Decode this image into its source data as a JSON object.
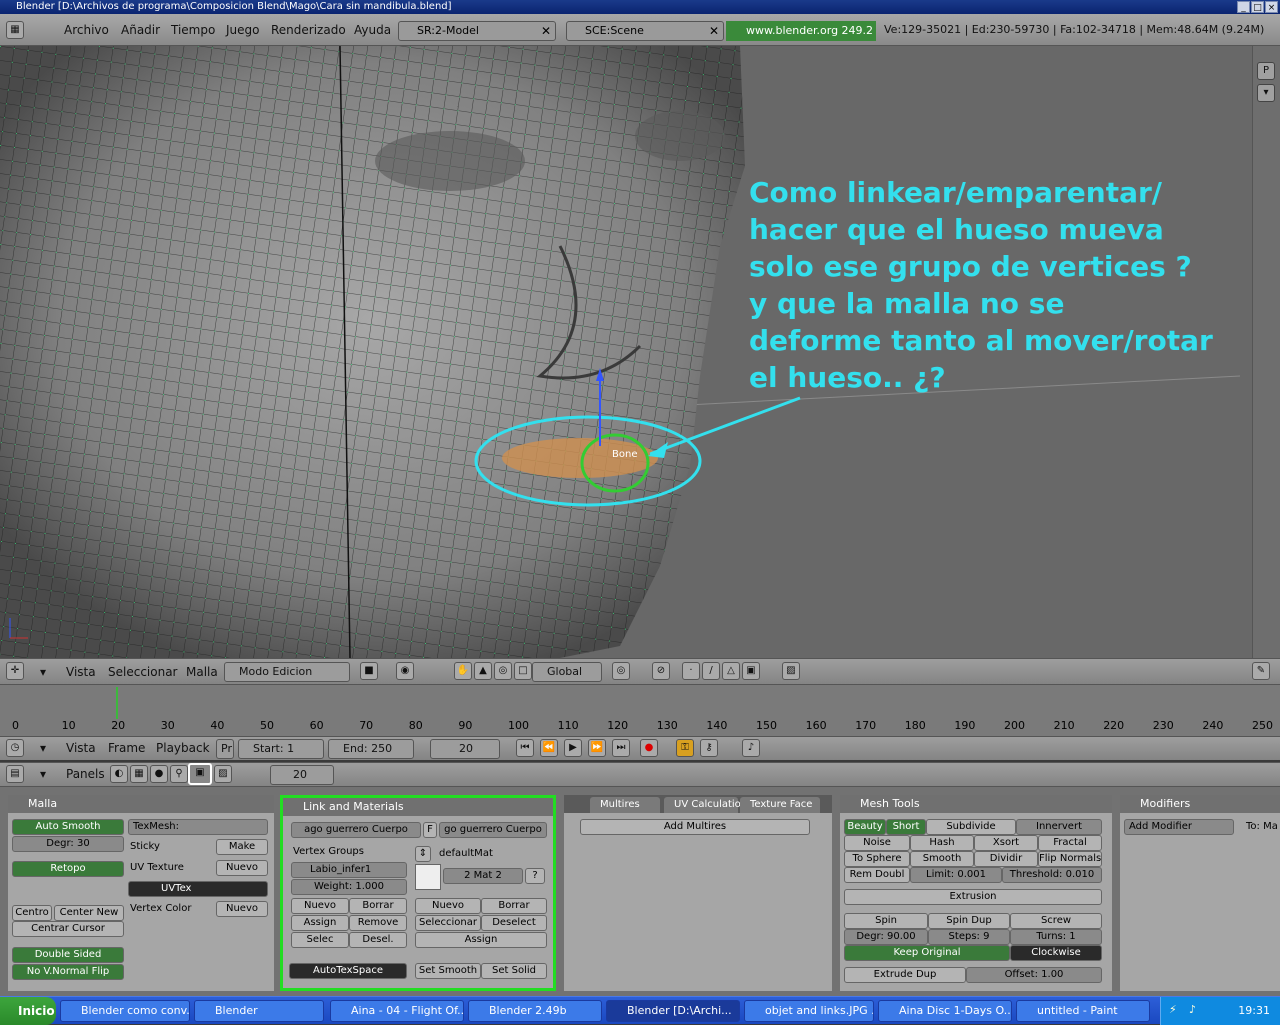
{
  "window": {
    "title": "Blender [D:\\Archivos de programa\\Composicion Blend\\Mago\\Cara sin mandibula.blend]",
    "min": "_",
    "max": "□",
    "close": "×"
  },
  "infobar": {
    "menus": [
      "Archivo",
      "Añadir",
      "Tiempo",
      "Juego",
      "Renderizado",
      "Ayuda"
    ],
    "screen": "SR:2-Model",
    "scene": "SCE:Scene",
    "url": "www.blender.org 249.2",
    "stats": "Ve:129-35021 | Ed:230-59730 | Fa:102-34718 | Mem:48.64M (9.24M)"
  },
  "viewport": {
    "question": "Como linkear/emparentar/\nhacer que el hueso mueva\nsolo ese grupo de vertices ?\ny que la malla no se\ndeforme tanto al mover/rotar\nel hueso.. ¿?",
    "bone_label": "Bone",
    "colors": {
      "annotation": "#33e0ee",
      "wire": "#33ff88",
      "selection": "#33cc33"
    }
  },
  "view_header": {
    "menus": [
      "Vista",
      "Seleccionar",
      "Malla"
    ],
    "mode": "Modo Edicion",
    "orientation": "Global"
  },
  "timeline": {
    "ticks": [
      "0",
      "10",
      "20",
      "30",
      "40",
      "50",
      "60",
      "70",
      "80",
      "90",
      "100",
      "110",
      "120",
      "130",
      "140",
      "150",
      "160",
      "170",
      "180",
      "190",
      "200",
      "210",
      "220",
      "230",
      "240",
      "250"
    ],
    "current_frame_marker": "20"
  },
  "time_header": {
    "menus": [
      "Vista",
      "Frame",
      "Playback"
    ],
    "pr": "Pr",
    "start": "Start: 1",
    "end": "End: 250",
    "frame": "20"
  },
  "btn_header": {
    "label": "Panels",
    "frame": "20"
  },
  "panels": {
    "malla": {
      "title": "Malla",
      "auto_smooth": "Auto Smooth",
      "degr": "Degr: 30",
      "retopo": "Retopo",
      "texmesh": "TexMesh:",
      "sticky": "Sticky",
      "make": "Make",
      "uv_texture": "UV Texture",
      "nuevo": "Nuevo",
      "uvtex": "UVTex",
      "vertex_color": "Vertex Color",
      "nuevo2": "Nuevo",
      "centro": "Centro",
      "center_new": "Center New",
      "centrar_cursor": "Centrar Cursor",
      "double_sided": "Double Sided",
      "no_vnormal_flip": "No V.Normal Flip"
    },
    "link": {
      "title": "Link and Materials",
      "me_field": "ago guerrero Cuerpo",
      "f": "F",
      "ob_field": "go guerrero Cuerpo",
      "vertex_groups": "Vertex Groups",
      "group_name": "Labio_infer1",
      "weight": "Weight: 1.000",
      "nuevo": "Nuevo",
      "borrar": "Borrar",
      "assign": "Assign",
      "remove": "Remove",
      "selec": "Selec",
      "desel": "Desel.",
      "mat_name": "defaultMat",
      "mat_count": "2 Mat 2",
      "q": "?",
      "mnuevo": "Nuevo",
      "mborrar": "Borrar",
      "seleccionar": "Seleccionar",
      "deselect": "Deselect",
      "massign": "Assign",
      "autotexspace": "AutoTexSpace",
      "set_smooth": "Set Smooth",
      "set_solid": "Set Solid"
    },
    "multires": {
      "tabs": [
        "Multires",
        "UV Calculation",
        "Texture Face"
      ],
      "add_multires": "Add Multires"
    },
    "meshtools": {
      "title": "Mesh Tools",
      "beauty": "Beauty",
      "short": "Short",
      "subdivide": "Subdivide",
      "innervert": "Innervert",
      "noise": "Noise",
      "hash": "Hash",
      "xsort": "Xsort",
      "fractal": "Fractal",
      "to_sphere": "To Sphere",
      "smooth": "Smooth",
      "dividir": "Dividir",
      "flip_normals": "Flip Normals",
      "rem_doubl": "Rem Doubl",
      "limit": "Limit: 0.001",
      "threshold": "Threshold: 0.010",
      "extrusion": "Extrusion",
      "spin": "Spin",
      "spin_dup": "Spin Dup",
      "screw": "Screw",
      "degr": "Degr: 90.00",
      "steps": "Steps: 9",
      "turns": "Turns: 1",
      "keep_original": "Keep Original",
      "clockwise": "Clockwise",
      "extrude_dup": "Extrude Dup",
      "offset": "Offset: 1.00"
    },
    "modifiers": {
      "title": "Modifiers",
      "add_modifier": "Add Modifier",
      "to": "To: Ma"
    }
  },
  "taskbar": {
    "start": "Inicio",
    "tasks": [
      "Blender como conv...",
      "Blender",
      "Aina - 04 - Flight Of...",
      "Blender 2.49b",
      "Blender [D:\\Archi...",
      "objet and links.JPG ...",
      "Aina Disc 1-Days O...",
      "untitled - Paint"
    ],
    "clock": "19:31"
  }
}
